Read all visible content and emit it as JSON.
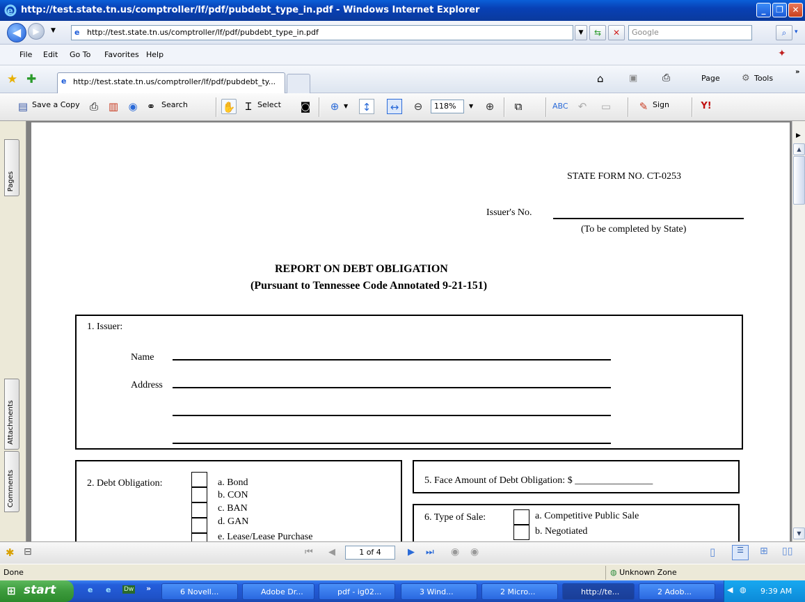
{
  "window": {
    "title": "http://test.state.tn.us/comptroller/lf/pdf/pubdebt_type_in.pdf - Windows Internet Explorer"
  },
  "address": {
    "url": "http://test.state.tn.us/comptroller/lf/pdf/pubdebt_type_in.pdf",
    "search_placeholder": "Google"
  },
  "menu": [
    "File",
    "Edit",
    "Go To",
    "Favorites",
    "Help"
  ],
  "tab": {
    "label": "http://test.state.tn.us/comptroller/lf/pdf/pubdebt_ty..."
  },
  "command_bar": {
    "page_label": "Page",
    "tools_label": "Tools"
  },
  "pdf_toolbar": {
    "save_copy": "Save a Copy",
    "search": "Search",
    "select": "Select",
    "zoom": "118%",
    "sign": "Sign"
  },
  "side_tabs": {
    "pages": "Pages",
    "attachments": "Attachments",
    "comments": "Comments"
  },
  "document": {
    "form_no": "STATE FORM NO. CT-0253",
    "issuers_no_label": "Issuer's No.",
    "issuers_no_note": "(To be completed by State)",
    "title": "REPORT ON DEBT OBLIGATION",
    "subtitle": "(Pursuant to Tennessee Code Annotated 9-21-151)",
    "issuer_label": "1. Issuer:",
    "name_label": "Name",
    "address_label": "Address",
    "debt_obligation_label": "2. Debt Obligation:",
    "debt_options": [
      "a. Bond",
      "b. CON",
      "c. BAN",
      "d. GAN",
      "e. Lease/Lease Purchase"
    ],
    "face_amount_label": "5. Face Amount of Debt Obligation:  $ ________________",
    "type_of_sale_label": "6. Type of Sale:",
    "sale_options": [
      "a. Competitive Public Sale",
      "b. Negotiated"
    ]
  },
  "nav": {
    "page_indicator": "1 of 4"
  },
  "status": {
    "left": "Done",
    "zone": "Unknown Zone"
  },
  "taskbar": {
    "start": "start",
    "items": [
      "6 Novell...",
      "Adobe Dr...",
      "pdf - ig02...",
      "3 Wind...",
      "2 Micro...",
      "http://te...",
      "2 Adob..."
    ],
    "clock": "9:39 AM"
  },
  "colors": {
    "title_blue": "#0a4fc8",
    "taskbar_blue": "#245edb",
    "start_green": "#3c9a3c"
  }
}
